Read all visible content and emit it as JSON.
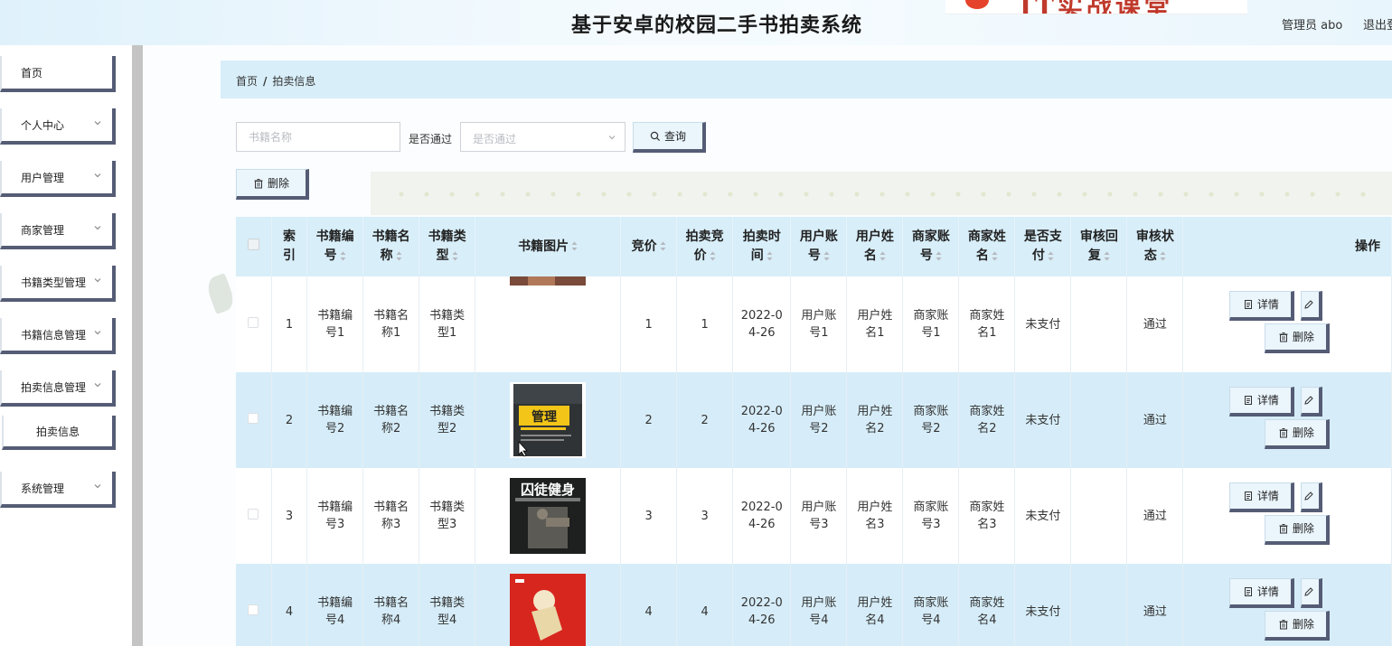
{
  "header": {
    "title": "基于安卓的校园二手书拍卖系统",
    "user_label": "管理员 abo",
    "logout_label": "退出登录",
    "logo_text": "IT实战课堂"
  },
  "sidebar": {
    "items": [
      {
        "label": "首页"
      },
      {
        "label": "个人中心"
      },
      {
        "label": "用户管理"
      },
      {
        "label": "商家管理"
      },
      {
        "label": "书籍类型管理"
      },
      {
        "label": "书籍信息管理"
      },
      {
        "label": "拍卖信息管理"
      }
    ],
    "sub_item": "拍卖信息",
    "last_item": "系统管理"
  },
  "breadcrumb": {
    "home": "首页",
    "separator": "/",
    "current": "拍卖信息"
  },
  "search": {
    "name_placeholder": "书籍名称",
    "pass_label": "是否通过",
    "pass_placeholder": "是否通过",
    "query_label": "查询",
    "delete_label": "删除"
  },
  "table": {
    "headers": [
      {
        "l1": "",
        "l2": ""
      },
      {
        "l1": "索",
        "l2": "引"
      },
      {
        "l1": "书籍编",
        "l2": "号"
      },
      {
        "l1": "书籍名",
        "l2": "称"
      },
      {
        "l1": "书籍类",
        "l2": "型"
      },
      {
        "l1": "书籍图片",
        "l2": ""
      },
      {
        "l1": "竞价",
        "l2": ""
      },
      {
        "l1": "拍卖竞",
        "l2": "价"
      },
      {
        "l1": "拍卖时",
        "l2": "间"
      },
      {
        "l1": "用户账",
        "l2": "号"
      },
      {
        "l1": "用户姓",
        "l2": "名"
      },
      {
        "l1": "商家账",
        "l2": "号"
      },
      {
        "l1": "商家姓",
        "l2": "名"
      },
      {
        "l1": "是否支",
        "l2": "付"
      },
      {
        "l1": "审核回",
        "l2": "复"
      },
      {
        "l1": "审核状",
        "l2": "态"
      },
      {
        "l1": "操作",
        "l2": ""
      }
    ],
    "detail_label": "详情",
    "delete_label": "删除",
    "rows": [
      {
        "index": "1",
        "code": [
          "书籍编",
          "号1"
        ],
        "name": [
          "书籍名",
          "称1"
        ],
        "type": [
          "书籍类",
          "型1"
        ],
        "bid": "1",
        "auction_bid": "1",
        "time": [
          "2022-0",
          "4-26"
        ],
        "user_acc": [
          "用户账",
          "号1"
        ],
        "user_name": [
          "用户姓",
          "名1"
        ],
        "shop_acc": [
          "商家账",
          "号1"
        ],
        "shop_name": [
          "商家姓",
          "名1"
        ],
        "paid": "未支付",
        "reply": "",
        "status": "通过",
        "cover_text": ""
      },
      {
        "index": "2",
        "code": [
          "书籍编",
          "号2"
        ],
        "name": [
          "书籍名",
          "称2"
        ],
        "type": [
          "书籍类",
          "型2"
        ],
        "bid": "2",
        "auction_bid": "2",
        "time": [
          "2022-0",
          "4-26"
        ],
        "user_acc": [
          "用户账",
          "号2"
        ],
        "user_name": [
          "用户姓",
          "名2"
        ],
        "shop_acc": [
          "商家账",
          "号2"
        ],
        "shop_name": [
          "商家姓",
          "名2"
        ],
        "paid": "未支付",
        "reply": "",
        "status": "通过",
        "cover_text": "管理"
      },
      {
        "index": "3",
        "code": [
          "书籍编",
          "号3"
        ],
        "name": [
          "书籍名",
          "称3"
        ],
        "type": [
          "书籍类",
          "型3"
        ],
        "bid": "3",
        "auction_bid": "3",
        "time": [
          "2022-0",
          "4-26"
        ],
        "user_acc": [
          "用户账",
          "号3"
        ],
        "user_name": [
          "用户姓",
          "名3"
        ],
        "shop_acc": [
          "商家账",
          "号3"
        ],
        "shop_name": [
          "商家姓",
          "名3"
        ],
        "paid": "未支付",
        "reply": "",
        "status": "通过",
        "cover_text": "囚徒健身"
      },
      {
        "index": "4",
        "code": [
          "书籍编",
          "号4"
        ],
        "name": [
          "书籍名",
          "称4"
        ],
        "type": [
          "书籍类",
          "型4"
        ],
        "bid": "4",
        "auction_bid": "4",
        "time": [
          "2022-0",
          "4-26"
        ],
        "user_acc": [
          "用户账",
          "号4"
        ],
        "user_name": [
          "用户姓",
          "名4"
        ],
        "shop_acc": [
          "商家账",
          "号4"
        ],
        "shop_name": [
          "商家姓",
          "名4"
        ],
        "paid": "未支付",
        "reply": "",
        "status": "通过",
        "cover_text": ""
      }
    ]
  },
  "colors": {
    "accent_border": "#555c75",
    "header_row_bg": "#d8eef9",
    "stripe_bg": "#d6edf9"
  }
}
